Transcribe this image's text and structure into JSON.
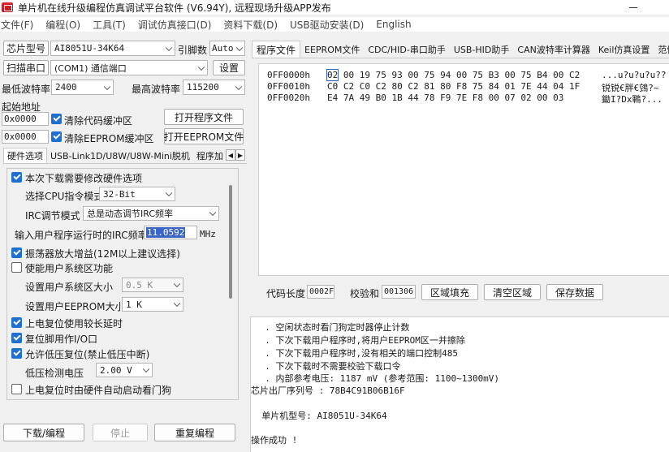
{
  "window": {
    "title": "单片机在线升级编程仿真调试平台软件 (V6.94Y), 远程现场升级APP发布"
  },
  "menu": [
    "文件(F)",
    "编程(O)",
    "工具(T)",
    "调试仿真接口(D)",
    "资料下载(D)",
    "USB驱动安装(D)",
    "English"
  ],
  "chip": {
    "button": "芯片型号",
    "model": "AI8051U-34K64",
    "pins_label": "引脚数",
    "pins_value": "Auto"
  },
  "port": {
    "scan_button": "扫描串口",
    "value": "(COM1) 通信端口",
    "settings_button": "设置"
  },
  "baud": {
    "min_label": "最低波特率",
    "min_value": "2400",
    "max_label": "最高波特率",
    "max_value": "115200"
  },
  "start_address": {
    "label": "起始地址",
    "code_value": "0x0000",
    "clear_code_label": "清除代码缓冲区",
    "open_program_button": "打开程序文件",
    "eeprom_value": "0x0000",
    "clear_eeprom_label": "清除EEPROM缓冲区",
    "open_eeprom_button": "打开EEPROM文件"
  },
  "left_tabs": [
    "硬件选项",
    "USB-Link1D/U8W/U8W-Mini脱机",
    "程序加"
  ],
  "options": {
    "modify_hw": "本次下载需要修改硬件选项",
    "cpu_mode_label": "选择CPU指令模式",
    "cpu_mode_value": "32-Bit",
    "irc_mode_label": "IRC调节模式",
    "irc_mode_value": "总是动态调节IRC频率",
    "irc_freq_label": "输入用户程序运行时的IRC频率",
    "irc_freq_value": "11.0592",
    "irc_freq_unit": "MHz",
    "osc_gain": "振荡器放大增益(12M以上建议选择)",
    "sys_area": "使能用户系统区功能",
    "sys_area_size_label": "设置用户系统区大小",
    "sys_area_size_value": "0.5 K",
    "eeprom_size_label": "设置用户EEPROM大小",
    "eeprom_size_value": "1   K",
    "long_reset": "上电复位使用较长延时",
    "reset_pin": "复位脚用作I/O口",
    "lvd_reset": "允许低压复位(禁止低压中断)",
    "lvd_label": "低压检测电压",
    "lvd_value": "2.00 V",
    "wdt_auto": "上电复位时由硬件自动启动看门狗"
  },
  "bottom_buttons": {
    "download": "下载/编程",
    "stop": "停止",
    "repeat": "重复编程"
  },
  "right_tabs": [
    "程序文件",
    "EEPROM文件",
    "CDC/HID-串口助手",
    "USB-HID助手",
    "CAN波特率计算器",
    "Keil仿真设置",
    "范例"
  ],
  "hex_rows": [
    {
      "addr": "0FF0000h",
      "bytes": "02 00 19 75 93 00 75 94 00 75 B3 00 75 B4 00 C2",
      "ascii": "...u?u?u?u??"
    },
    {
      "addr": "0FF0010h",
      "bytes": "C0 C2 C0 C2 80 C2 81 80 F8 75 84 01 7E 44 04 1F",
      "ascii": "锐锐€胖€鵼?~"
    },
    {
      "addr": "0FF0020h",
      "bytes": "E4 7A 49 B0 1B 44 78 F9 7E F8 00 07 02 00 03",
      "ascii": "鋤I?Dx鶤?..."
    }
  ],
  "code_info": {
    "length_label": "代码长度",
    "length_value": "0002F",
    "checksum_label": "校验和",
    "checksum_value": "001306",
    "fill_button": "区域填充",
    "clear_button": "清空区域",
    "save_button": "保存数据"
  },
  "log": [
    "  . 空闲状态时看门狗定时器停止计数",
    "  . 下次下载用户程序时,将用户EEPROM区一并擦除",
    "  . 下次下载用户程序时,没有相关的端口控制485",
    "  . 下次下载时不需要校验下载口令",
    "  . 内部参考电压: 1187 mV (参考范围: 1100~1300mV)",
    "芯片出厂序列号 : 78B4C91B06B16F",
    "",
    "  单片机型号: AI8051U-34K64",
    "",
    "操作成功 !"
  ],
  "colors": {
    "accent": "#1f6fd0",
    "selection": "#3a64c8",
    "log_bg": "#ffffff"
  }
}
